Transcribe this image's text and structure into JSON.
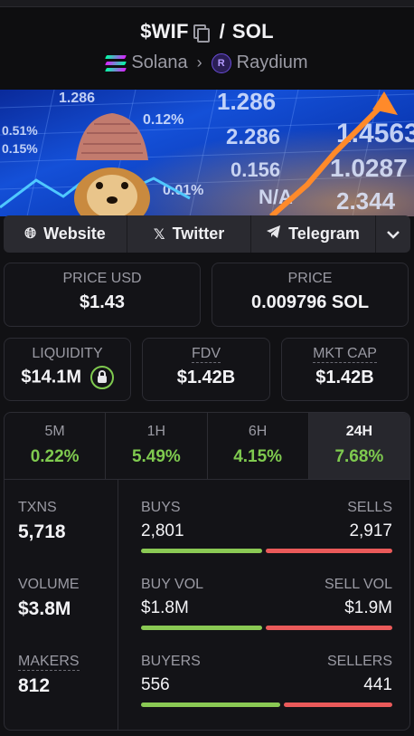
{
  "header": {
    "token": "$WIF",
    "quote": "SOL",
    "chain": "Solana",
    "dex": "Raydium",
    "dex_icon_letter": "R"
  },
  "banner": {
    "ticker_numbers": [
      "1.286",
      "1.286",
      "2.286",
      "0.156",
      "1.4563",
      "1.0287",
      "2.344",
      "0.12%",
      "0.15%",
      "0.51%",
      "0.01%",
      "N/A"
    ]
  },
  "links": {
    "website": "Website",
    "twitter": "Twitter",
    "telegram": "Telegram"
  },
  "price": {
    "usd_label": "PRICE USD",
    "usd_value": "$1.43",
    "native_label": "PRICE",
    "native_value": "0.009796 SOL"
  },
  "metrics": {
    "liquidity_label": "LIQUIDITY",
    "liquidity_value": "$14.1M",
    "fdv_label": "FDV",
    "fdv_value": "$1.42B",
    "mktcap_label": "MKT CAP",
    "mktcap_value": "$1.42B"
  },
  "tabs": [
    {
      "label": "5M",
      "change": "0.22%"
    },
    {
      "label": "1H",
      "change": "5.49%"
    },
    {
      "label": "6H",
      "change": "4.15%"
    },
    {
      "label": "24H",
      "change": "7.68%"
    }
  ],
  "stats": {
    "txns_label": "TXNS",
    "txns_value": "5,718",
    "volume_label": "VOLUME",
    "volume_value": "$3.8M",
    "makers_label": "MAKERS",
    "makers_value": "812",
    "buys_label": "BUYS",
    "buys_value": "2,801",
    "sells_label": "SELLS",
    "sells_value": "2,917",
    "buys_share": 0.49,
    "buyvol_label": "BUY VOL",
    "buyvol_value": "$1.8M",
    "sellvol_label": "SELL VOL",
    "sellvol_value": "$1.9M",
    "buyvol_share": 0.49,
    "buyers_label": "BUYERS",
    "buyers_value": "556",
    "sellers_label": "SELLERS",
    "sellers_value": "441",
    "buyers_share": 0.56
  },
  "colors": {
    "positive": "#7fca4f",
    "negative": "#ea5a5a",
    "background": "#111114"
  }
}
